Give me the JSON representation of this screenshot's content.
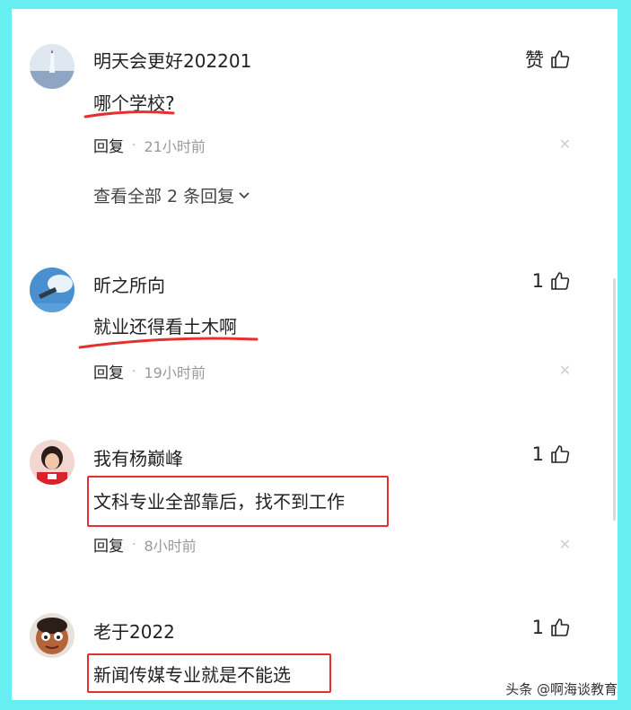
{
  "comments": [
    {
      "username": "明天会更好202201",
      "like_label": "赞",
      "text": "哪个学校?",
      "reply_label": "回复",
      "time": "21小时前",
      "view_all": "查看全部 2 条回复"
    },
    {
      "username": "昕之所向",
      "like_count": "1",
      "text": "就业还得看土木啊",
      "reply_label": "回复",
      "time": "19小时前"
    },
    {
      "username": "我有杨巅峰",
      "like_count": "1",
      "text": "文科专业全部靠后，找不到工作",
      "reply_label": "回复",
      "time": "8小时前"
    },
    {
      "username": "老于2022",
      "like_count": "1",
      "text": "新闻传媒专业就是不能选"
    }
  ],
  "watermark": "头条 @啊海谈教育",
  "icons": {
    "like": "thumbs-up-icon",
    "close": "close-icon",
    "expand": "chevron-down-icon"
  },
  "colors": {
    "frame": "#66eef0",
    "annotation_red": "#e53030",
    "meta_gray": "#9a9a9a"
  }
}
